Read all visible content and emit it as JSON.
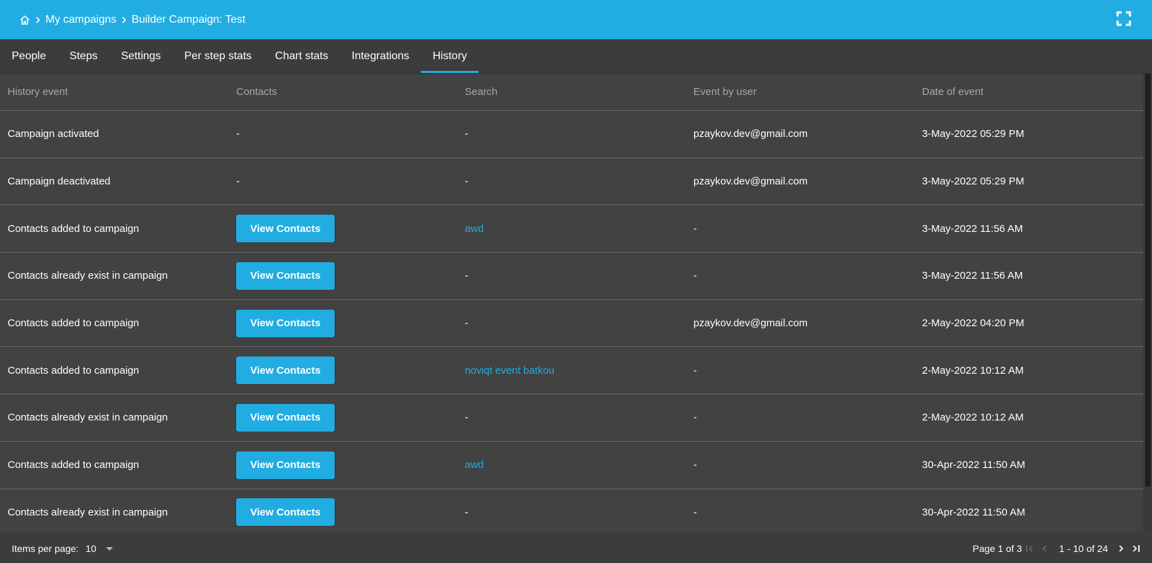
{
  "breadcrumb": {
    "home_icon": "home-icon",
    "items": [
      "My campaigns",
      "Builder Campaign: Test"
    ]
  },
  "header": {
    "fullscreen_icon": "fullscreen-icon"
  },
  "tabs": [
    {
      "label": "People",
      "active": false
    },
    {
      "label": "Steps",
      "active": false
    },
    {
      "label": "Settings",
      "active": false
    },
    {
      "label": "Per step stats",
      "active": false
    },
    {
      "label": "Chart stats",
      "active": false
    },
    {
      "label": "Integrations",
      "active": false
    },
    {
      "label": "History",
      "active": true
    }
  ],
  "table": {
    "columns": [
      "History event",
      "Contacts",
      "Search",
      "Event by user",
      "Date of event"
    ],
    "view_contacts_label": "View Contacts",
    "rows": [
      {
        "event": "Campaign activated",
        "contacts": "-",
        "search": "-",
        "user": "pzaykov.dev@gmail.com",
        "date": "3-May-2022 05:29 PM"
      },
      {
        "event": "Campaign deactivated",
        "contacts": "-",
        "search": "-",
        "user": "pzaykov.dev@gmail.com",
        "date": "3-May-2022 05:29 PM"
      },
      {
        "event": "Contacts added to campaign",
        "contacts": "button",
        "search": "awd",
        "user": "-",
        "date": "3-May-2022 11:56 AM"
      },
      {
        "event": "Contacts already exist in campaign",
        "contacts": "button",
        "search": "-",
        "user": "-",
        "date": "3-May-2022 11:56 AM"
      },
      {
        "event": "Contacts added to campaign",
        "contacts": "button",
        "search": "-",
        "user": "pzaykov.dev@gmail.com",
        "date": "2-May-2022 04:20 PM"
      },
      {
        "event": "Contacts added to campaign",
        "contacts": "button",
        "search": "noviqt event batkou",
        "user": "-",
        "date": "2-May-2022 10:12 AM"
      },
      {
        "event": "Contacts already exist in campaign",
        "contacts": "button",
        "search": "-",
        "user": "-",
        "date": "2-May-2022 10:12 AM"
      },
      {
        "event": "Contacts added to campaign",
        "contacts": "button",
        "search": "awd",
        "user": "-",
        "date": "30-Apr-2022 11:50 AM"
      },
      {
        "event": "Contacts already exist in campaign",
        "contacts": "button",
        "search": "-",
        "user": "-",
        "date": "30-Apr-2022 11:50 AM"
      }
    ]
  },
  "footer": {
    "items_per_page_label": "Items per page:",
    "items_per_page_value": "10",
    "page_label": "Page 1 of 3",
    "range_label": "1 - 10 of 24"
  },
  "colors": {
    "accent": "#22ade2",
    "background": "#424242"
  }
}
